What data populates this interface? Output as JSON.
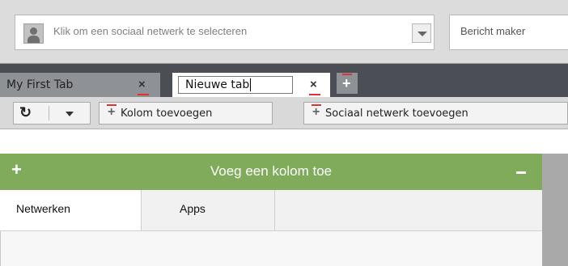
{
  "header": {
    "network_placeholder": "Klik om een sociaal netwerk te selecteren",
    "message_placeholder": "Bericht maker"
  },
  "tabs": [
    {
      "label": "My First Tab",
      "close": "×"
    },
    {
      "label": "Nieuwe tab",
      "close": "×"
    }
  ],
  "add_tab": "+",
  "toolbar": {
    "add_column": "Kolom toevoegen",
    "add_network": "Sociaal netwerk toevoegen"
  },
  "column": {
    "title": "Voeg een kolom toe",
    "plus": "+",
    "color": "#7fab5b"
  },
  "panel_tabs": [
    "Netwerken",
    "Apps"
  ],
  "icons": {
    "refresh": "↻",
    "avatar": "user-icon",
    "dropdown": "chevron-down-icon"
  }
}
